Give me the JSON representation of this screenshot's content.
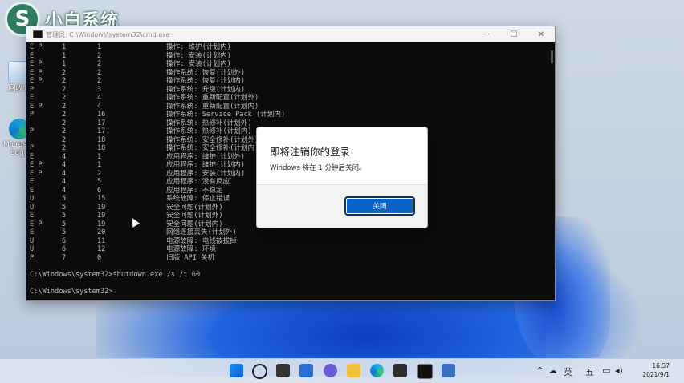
{
  "brand": {
    "name": "小白系统",
    "logo_glyph": "S"
  },
  "desktop_icons": [
    {
      "label": "回收站",
      "icon": "recycle-bin-icon"
    },
    {
      "label": "Microsoft Edge",
      "icon": "edge-icon"
    }
  ],
  "cmd": {
    "title": "管理员: C:\\Windows\\system32\\cmd.exe",
    "rows": [
      [
        "E P",
        "1",
        "1",
        "操作: 维护(计划内)"
      ],
      [
        "E",
        "1",
        "2",
        "操作: 安装(计划内)"
      ],
      [
        "E P",
        "1",
        "2",
        "操作: 安装(计划内)"
      ],
      [
        "E P",
        "2",
        "2",
        "操作系统: 恢复(计划外)"
      ],
      [
        "E P",
        "2",
        "2",
        "操作系统: 恢复(计划内)"
      ],
      [
        "P",
        "2",
        "3",
        "操作系统: 升级(计划内)"
      ],
      [
        "E",
        "2",
        "4",
        "操作系统: 重新配置(计划外)"
      ],
      [
        "E P",
        "2",
        "4",
        "操作系统: 重新配置(计划内)"
      ],
      [
        "P",
        "2",
        "16",
        "操作系统: Service Pack (计划内)"
      ],
      [
        "",
        "2",
        "17",
        "操作系统: 热修补(计划外)"
      ],
      [
        "P",
        "2",
        "17",
        "操作系统: 热修补(计划内)"
      ],
      [
        "",
        "2",
        "18",
        "操作系统: 安全修补(计划外)"
      ],
      [
        "P",
        "2",
        "18",
        "操作系统: 安全修补(计划内)"
      ],
      [
        "E",
        "4",
        "1",
        "应用程序: 维护(计划外)"
      ],
      [
        "E P",
        "4",
        "1",
        "应用程序: 维护(计划内)"
      ],
      [
        "E P",
        "4",
        "2",
        "应用程序: 安装(计划内)"
      ],
      [
        "E",
        "4",
        "5",
        "应用程序: 没有反应"
      ],
      [
        "E",
        "4",
        "6",
        "应用程序: 不稳定"
      ],
      [
        "U",
        "5",
        "15",
        "系统故障: 停止错误"
      ],
      [
        "U",
        "5",
        "19",
        "安全问题(计划外)"
      ],
      [
        "E",
        "5",
        "19",
        "安全问题(计划外)"
      ],
      [
        "E P",
        "5",
        "19",
        "安全问题(计划内)"
      ],
      [
        "E",
        "5",
        "20",
        "网络连接丢失(计划外)"
      ],
      [
        "U",
        "6",
        "11",
        "电源故障: 电线被拔掉"
      ],
      [
        "U",
        "6",
        "12",
        "电源故障: 环境"
      ],
      [
        "P",
        "7",
        "0",
        "旧版 API 关机"
      ]
    ],
    "prompt1": "C:\\Windows\\system32>shutdown.exe /s /t 60",
    "prompt2": "C:\\Windows\\system32>"
  },
  "dialog": {
    "title": "即将注销你的登录",
    "message": "Windows 将在 1 分钟后关闭。",
    "close_label": "关闭"
  },
  "tray": {
    "chevron": "^",
    "ime": "英",
    "input_mode": "五"
  },
  "clock": {
    "time": "16:57",
    "date": "2021/9/1"
  },
  "colors": {
    "accent": "#0a63c9",
    "cmd_bg": "#0c0c0c"
  }
}
